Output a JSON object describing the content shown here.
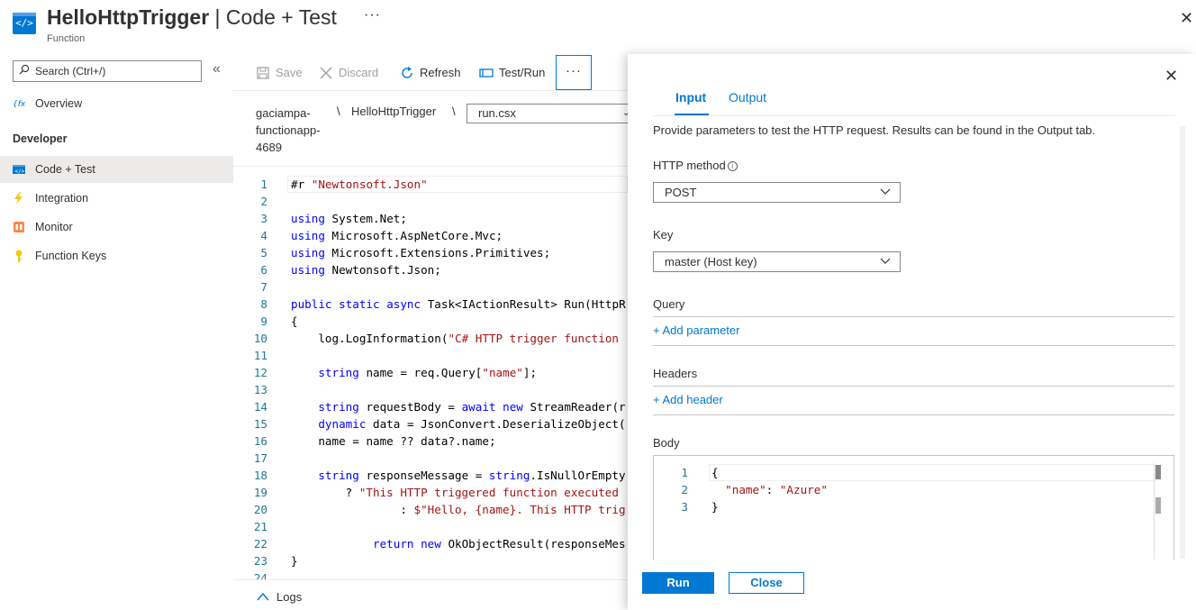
{
  "header": {
    "icon_text": "</>",
    "title_bold": "HelloHttpTrigger",
    "title_rest": " | Code + Test",
    "subtitle": "Function",
    "more_label": "···",
    "close_label": "✕"
  },
  "sidebar": {
    "search_placeholder": "Search (Ctrl+/)",
    "collapse_label": "«",
    "overview_label": "Overview",
    "section_label": "Developer",
    "items": [
      {
        "label": "Code + Test",
        "icon": "code-icon",
        "active": true
      },
      {
        "label": "Integration",
        "icon": "lightning-icon",
        "active": false
      },
      {
        "label": "Monitor",
        "icon": "monitor-icon",
        "active": false
      },
      {
        "label": "Function Keys",
        "icon": "key-icon",
        "active": false
      }
    ]
  },
  "toolbar": {
    "save": "Save",
    "discard": "Discard",
    "refresh": "Refresh",
    "test_run": "Test/Run",
    "more": "···"
  },
  "breadcrumb": {
    "app": "gaciampa-functionapp-4689",
    "sep": "\\",
    "function": "HelloHttpTrigger",
    "file": "run.csx"
  },
  "code": {
    "lines": [
      {
        "n": "1",
        "t": "#r \"Newtonsoft.Json\""
      },
      {
        "n": "2",
        "t": ""
      },
      {
        "n": "3",
        "t": "using System.Net;"
      },
      {
        "n": "4",
        "t": "using Microsoft.AspNetCore.Mvc;"
      },
      {
        "n": "5",
        "t": "using Microsoft.Extensions.Primitives;"
      },
      {
        "n": "6",
        "t": "using Newtonsoft.Json;"
      },
      {
        "n": "7",
        "t": ""
      },
      {
        "n": "8",
        "t": "public static async Task<IActionResult> Run(HttpR"
      },
      {
        "n": "9",
        "t": "{"
      },
      {
        "n": "10",
        "t": "    log.LogInformation(\"C# HTTP trigger function"
      },
      {
        "n": "11",
        "t": ""
      },
      {
        "n": "12",
        "t": "    string name = req.Query[\"name\"];"
      },
      {
        "n": "13",
        "t": ""
      },
      {
        "n": "14",
        "t": "    string requestBody = await new StreamReader(r"
      },
      {
        "n": "15",
        "t": "    dynamic data = JsonConvert.DeserializeObject("
      },
      {
        "n": "16",
        "t": "    name = name ?? data?.name;"
      },
      {
        "n": "17",
        "t": ""
      },
      {
        "n": "18",
        "t": "    string responseMessage = string.IsNullOrEmpty"
      },
      {
        "n": "19",
        "t": "        ? \"This HTTP triggered function executed"
      },
      {
        "n": "20",
        "t": "                : $\"Hello, {name}. This HTTP trig"
      },
      {
        "n": "21",
        "t": ""
      },
      {
        "n": "22",
        "t": "            return new OkObjectResult(responseMes"
      },
      {
        "n": "23",
        "t": "}"
      },
      {
        "n": "24",
        "t": ""
      }
    ]
  },
  "logs": {
    "label": "Logs"
  },
  "panel": {
    "close_label": "✕",
    "tab_input": "Input",
    "tab_output": "Output",
    "description": "Provide parameters to test the HTTP request. Results can be found in the Output tab.",
    "http_method_label": "HTTP method",
    "http_method_value": "POST",
    "key_label": "Key",
    "key_value": "master (Host key)",
    "query_label": "Query",
    "add_parameter": "+ Add parameter",
    "headers_label": "Headers",
    "add_header": "+ Add header",
    "body_label": "Body",
    "body_lines": [
      {
        "n": "1",
        "t": "{"
      },
      {
        "n": "2",
        "t": "  \"name\": \"Azure\""
      },
      {
        "n": "3",
        "t": "}"
      }
    ],
    "run_button": "Run",
    "close_button": "Close"
  },
  "colors": {
    "accent": "#0078d4",
    "keyword": "#0000ff",
    "string": "#a31515",
    "line_number": "#237893"
  }
}
